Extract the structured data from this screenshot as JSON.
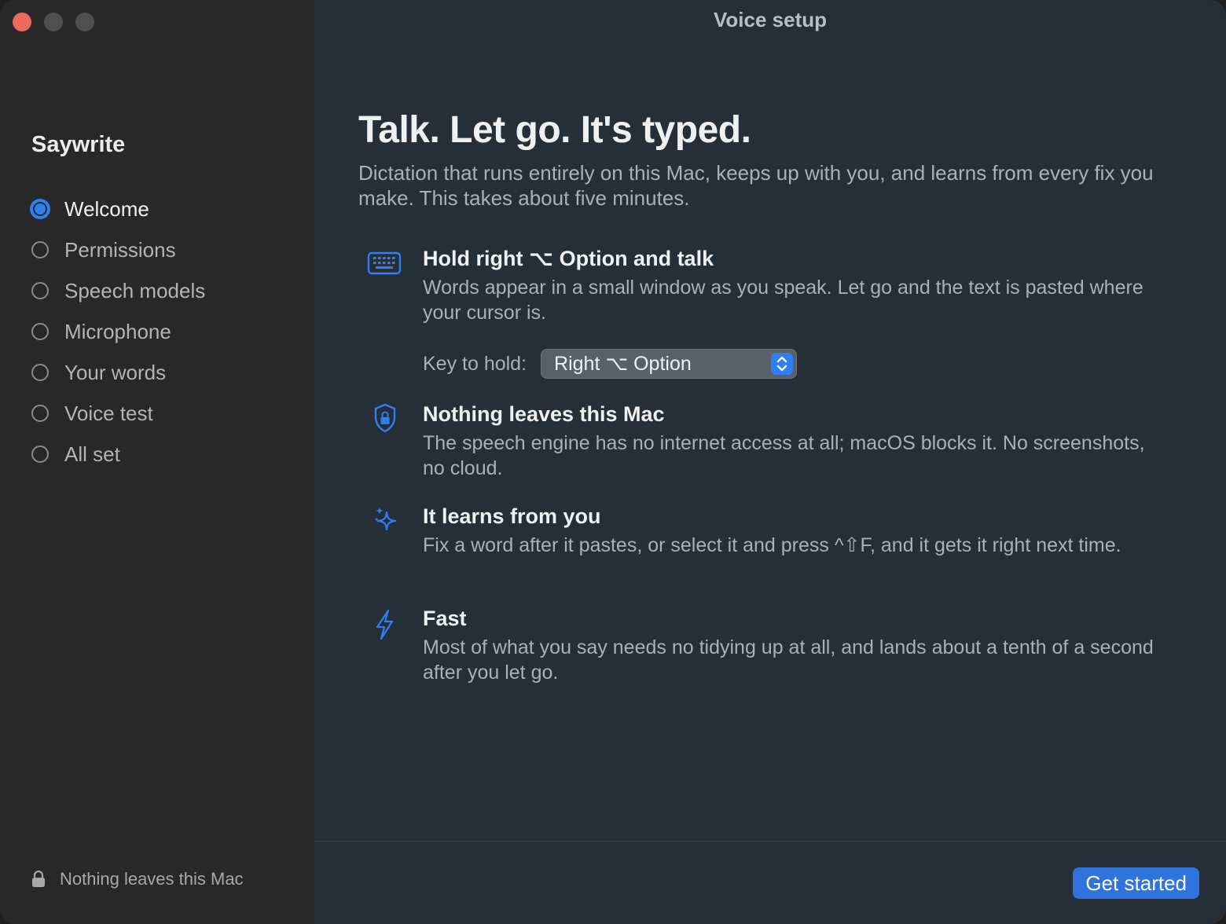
{
  "window": {
    "title": "Voice setup"
  },
  "sidebar": {
    "app_name": "Saywrite",
    "steps": [
      {
        "label": "Welcome",
        "active": true
      },
      {
        "label": "Permissions",
        "active": false
      },
      {
        "label": "Speech models",
        "active": false
      },
      {
        "label": "Microphone",
        "active": false
      },
      {
        "label": "Your words",
        "active": false
      },
      {
        "label": "Voice test",
        "active": false
      },
      {
        "label": "All set",
        "active": false
      }
    ],
    "footer_note": "Nothing leaves this Mac"
  },
  "main": {
    "headline": "Talk. Let go. It's typed.",
    "intro": "Dictation that runs entirely on this Mac, keeps up with you, and learns from every fix you make. This takes about five minutes.",
    "features": [
      {
        "icon": "keyboard-icon",
        "title": "Hold right ⌥ Option and talk",
        "description": "Words appear in a small window as you speak. Let go and the text is pasted where your cursor is."
      },
      {
        "icon": "lock-shield-icon",
        "title": "Nothing leaves this Mac",
        "description": "The speech engine has no internet access at all; macOS blocks it. No screenshots, no cloud."
      },
      {
        "icon": "sparkles-icon",
        "title": "It learns from you",
        "description": "Fix a word after it pastes, or select it and press ^⇧F, and it gets it right next time."
      },
      {
        "icon": "bolt-icon",
        "title": "Fast",
        "description": "Most of what you say needs no tidying up at all, and lands about a tenth of a second after you let go."
      }
    ],
    "key_select": {
      "label": "Key to hold:",
      "value": "Right ⌥ Option"
    },
    "primary_button": "Get started"
  },
  "colors": {
    "accent": "#2f7ff4",
    "sidebar_bg": "#282828",
    "main_bg": "#262f38",
    "close": "#ed6a5e"
  }
}
